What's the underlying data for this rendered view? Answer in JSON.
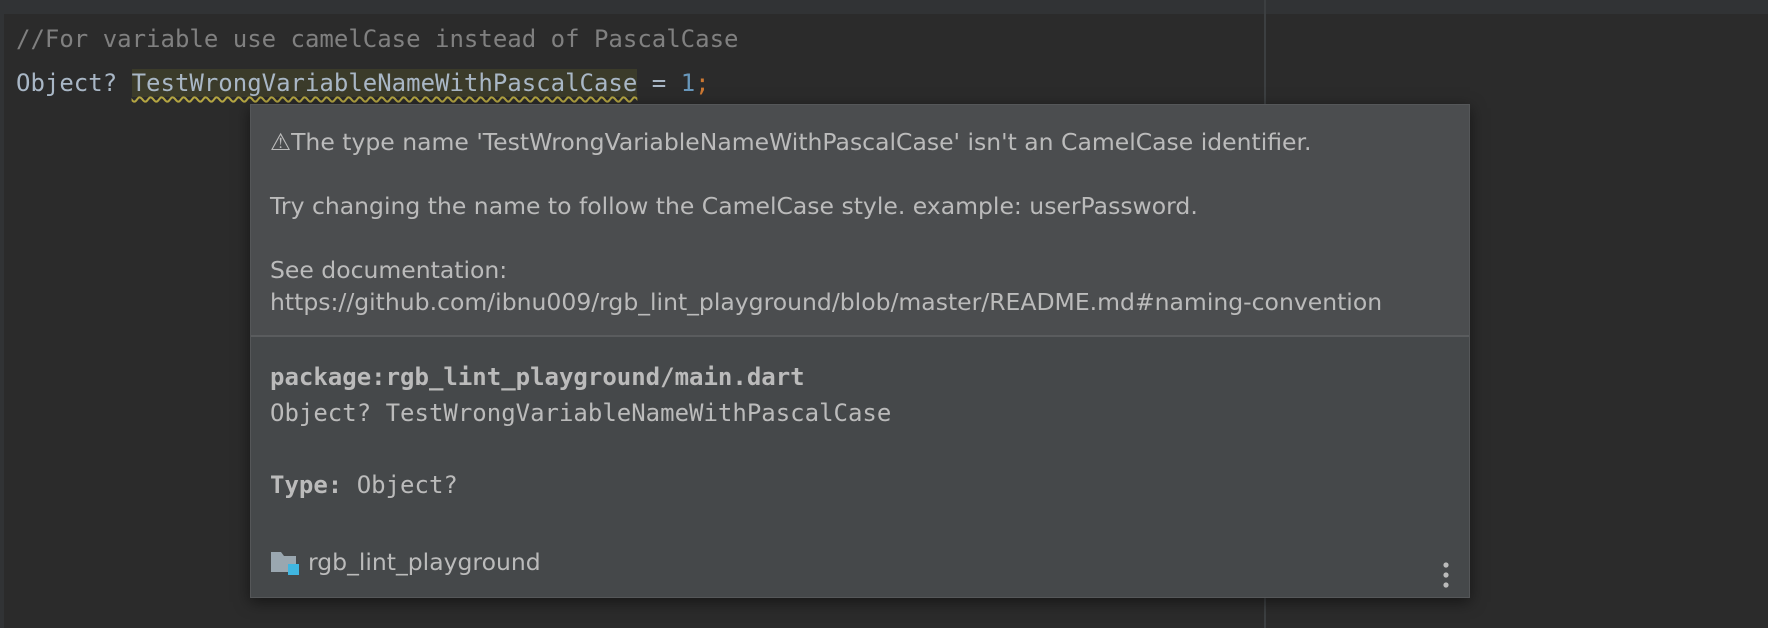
{
  "editor": {
    "comment_line": "//For variable use camelCase instead of PascalCase",
    "code": {
      "type_text": "Object? ",
      "identifier": "TestWrongVariableNameWithPascalCase",
      "assign": " = ",
      "number": "1",
      "semicolon": ";"
    }
  },
  "popup": {
    "problem_message": "The type name 'TestWrongVariableNameWithPascalCase' isn't an CamelCase identifier.",
    "correction": "Try changing the name to follow the CamelCase style. example: userPassword.",
    "doc_label": "See documentation:",
    "doc_url": "https://github.com/ibnu009/rgb_lint_playground/blob/master/README.md#naming-convention",
    "package_path": "package:rgb_lint_playground/main.dart",
    "declaration": "Object? TestWrongVariableNameWithPascalCase",
    "type_label": "Type:",
    "type_value": " Object?",
    "project_name": "rgb_lint_playground",
    "icons": {
      "warning": "warning-icon",
      "folder": "module-folder-icon",
      "more": "more-vertical-icon"
    }
  },
  "colors": {
    "editor_bg": "#2b2b2b",
    "popup_bg": "#45484a",
    "comment": "#808080",
    "code_text": "#a9b7c6",
    "number": "#6897bb",
    "keyword_punct": "#cc7832",
    "warning_underline": "#b5a642"
  }
}
